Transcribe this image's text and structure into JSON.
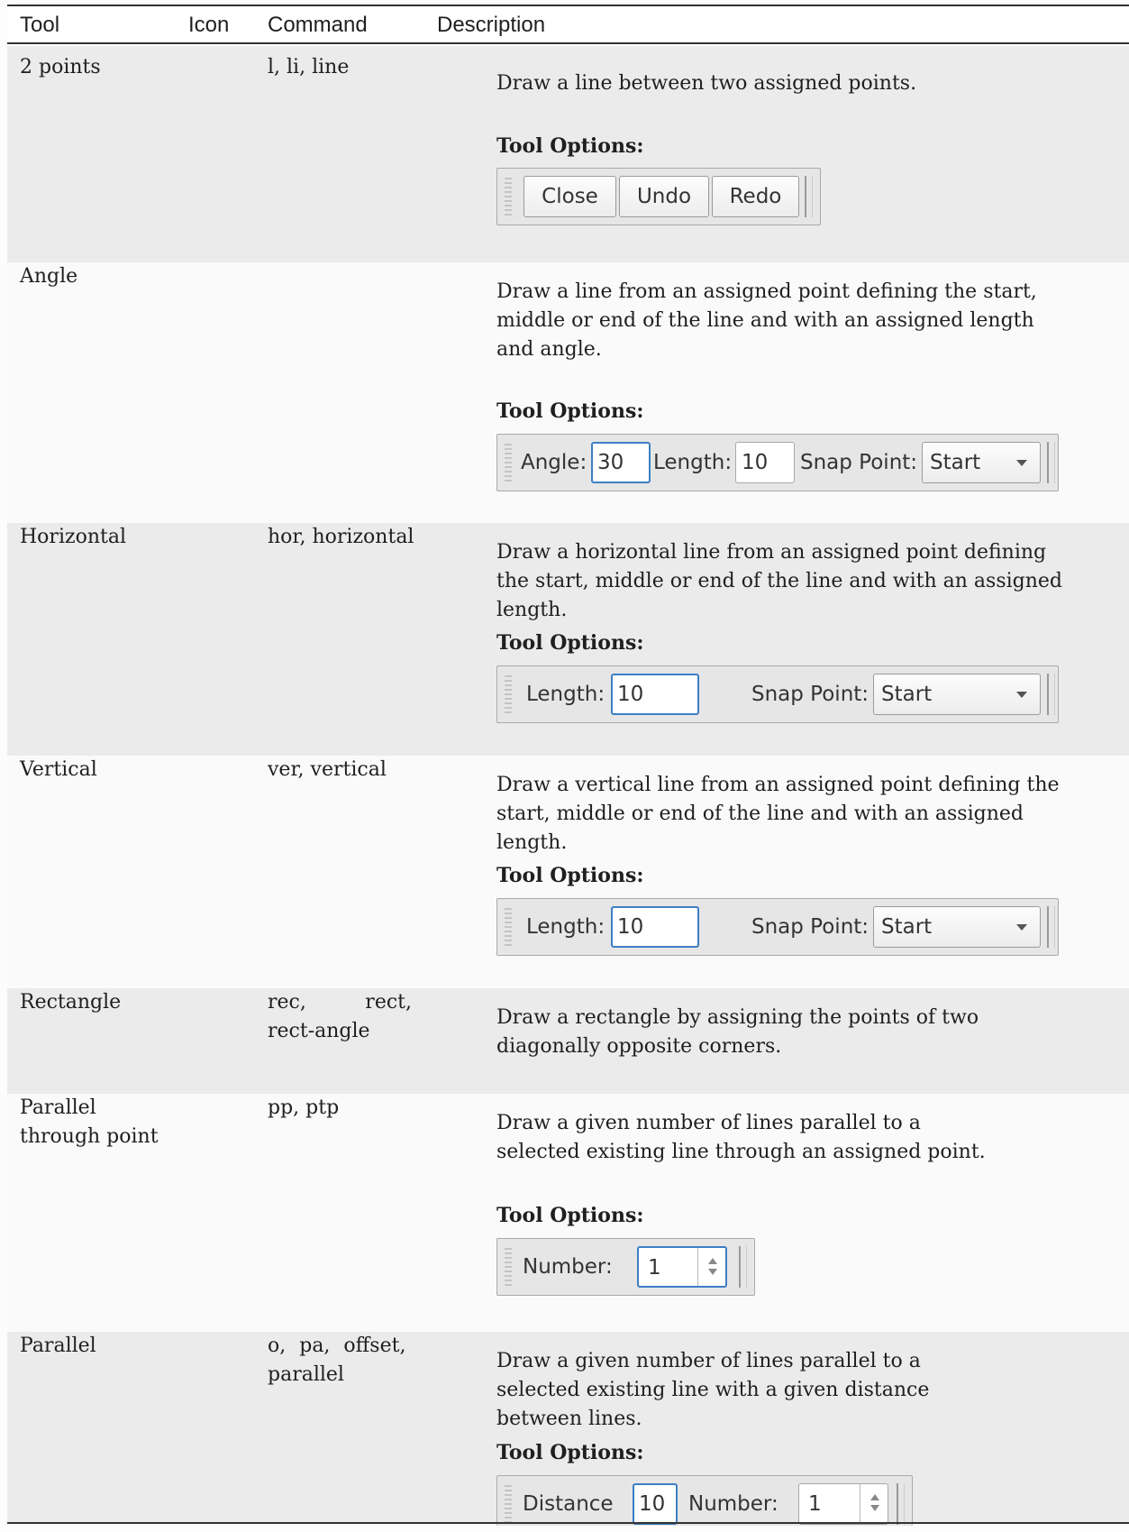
{
  "header": {
    "tool": "Tool",
    "icon": "Icon",
    "command": "Command",
    "description": "Description"
  },
  "rows": [
    {
      "tool": "2 points",
      "command": "l, li, line",
      "description": "Draw a line between two assigned points.",
      "options_label": "Tool Options:",
      "toolbar": {
        "close": "Close",
        "undo": "Undo",
        "redo": "Redo"
      }
    },
    {
      "tool": "Angle",
      "command": "",
      "description": "Draw a line from an assigned point defining the start, middle or end of the line and with an assigned length and angle.",
      "options_label": "Tool Options:",
      "toolbar": {
        "angle_label": "Angle:",
        "angle_value": "30",
        "length_label": "Length:",
        "length_value": "10",
        "snap_label": "Snap Point:",
        "snap_value": "Start"
      }
    },
    {
      "tool": "Horizontal",
      "command": "hor, horizontal",
      "description": "Draw a horizontal line from an assigned point defining the start, middle or end of the line and with an assigned length.",
      "options_label": "Tool Options:",
      "toolbar": {
        "length_label": "Length:",
        "length_value": "10",
        "snap_label": "Snap Point:",
        "snap_value": "Start"
      }
    },
    {
      "tool": "Vertical",
      "command": "ver, vertical",
      "description": "Draw a vertical line from an assigned point defining the start, middle or end of the line and with an assigned length.",
      "options_label": "Tool Options:",
      "toolbar": {
        "length_label": "Length:",
        "length_value": "10",
        "snap_label": "Snap Point:",
        "snap_value": "Start"
      }
    },
    {
      "tool": "Rectangle",
      "command": "rec, rect, rect-angle",
      "description": "Draw a rectangle by assigning the points of two diagonally opposite corners."
    },
    {
      "tool": "Parallel through point",
      "command": "pp, ptp",
      "description": "Draw a given number of lines parallel to a selected existing line through an assigned point.",
      "options_label": "Tool Options:",
      "toolbar": {
        "number_label": "Number:",
        "number_value": "1"
      }
    },
    {
      "tool": "Parallel",
      "command": "o, pa, offset, parallel",
      "description": "Draw a given number of lines parallel to a selected existing line with a given distance between lines.",
      "options_label": "Tool Options:",
      "toolbar": {
        "distance_label": "Distance",
        "distance_value": "10",
        "number_label": "Number:",
        "number_value": "1"
      }
    }
  ]
}
